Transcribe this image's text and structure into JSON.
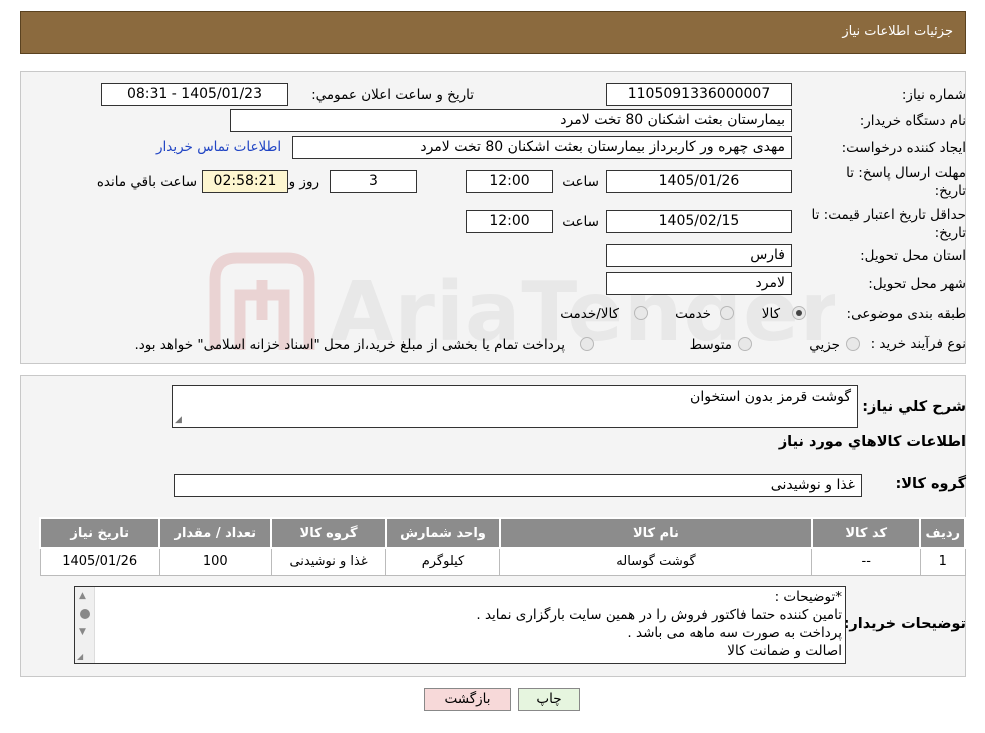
{
  "header": {
    "title": "جزئیات اطلاعات نیاز"
  },
  "form": {
    "need_number_label": "شماره نیاز:",
    "need_number": "1105091336000007",
    "announce_label": "تاریخ و ساعت اعلان عمومي:",
    "announce_value": "1405/01/23 - 08:31",
    "buyer_org_label": "نام دستگاه خريدار:",
    "buyer_org": "بیمارستان بعثت اشکنان 80 تخت لامرد",
    "creator_label": "ايجاد کننده درخواست:",
    "creator": "مهدی چهره ور کاربرداز بیمارستان بعثت اشکنان 80 تخت لامرد",
    "contact_link": "اطلاعات تماس خریدار",
    "deadline_label_1": "مهلت ارسال پاسخ: تا",
    "deadline_label_2": "تاریخ:",
    "deadline_date": "1405/01/26",
    "time_label": "ساعت",
    "deadline_time": "12:00",
    "days_value": "3",
    "days_label": "روز و",
    "remaining_time": "02:58:21",
    "remaining_label": "ساعت باقي مانده",
    "validity_label_1": "حداقل تاريخ اعتبار قيمت: تا",
    "validity_label_2": "تاریخ:",
    "validity_date": "1405/02/15",
    "validity_time": "12:00",
    "province_label": "استان محل تحويل:",
    "province": "فارس",
    "city_label": "شهر محل تحويل:",
    "city": "لامرد",
    "category_label": "طبقه بندی موضوعی:",
    "category_options": [
      "کالا",
      "خدمت",
      "کالا/خدمت"
    ],
    "category_selected": "کالا",
    "process_label": "نوع فرآيند خريد :",
    "process_options": [
      "جزيي",
      "متوسط"
    ],
    "process_note": "پرداخت تمام یا بخشی از مبلغ خرید،از محل \"اسناد خزانه اسلامی\" خواهد بود."
  },
  "summary": {
    "desc_label": "شرح کلي نياز:",
    "desc_value": "گوشت قرمز بدون استخوان",
    "goods_info_title": "اطلاعات کالاهاي مورد نياز",
    "goods_group_label": "گروه کالا:",
    "goods_group_value": "غذا و نوشیدنی",
    "table": {
      "headers": [
        "رديف",
        "کد کالا",
        "نام کالا",
        "واحد شمارش",
        "گروه کالا",
        "تعداد / مقدار",
        "تاريخ نياز"
      ],
      "rows": [
        [
          "1",
          "--",
          "گوشت گوساله",
          "کیلوگرم",
          "غذا و نوشیدنی",
          "100",
          "1405/01/26"
        ]
      ]
    },
    "buyer_notes_label": "توضیحات خریدار:",
    "buyer_notes": [
      "*توضیحات :",
      "تامین کننده حتما فاکتور فروش را در همین سایت بارگزاری نماید .",
      "پرداخت به صورت سه ماهه می باشد .",
      "اصالت و ضمانت کالا"
    ]
  },
  "buttons": {
    "print": "چاپ",
    "back": "بازگشت"
  },
  "watermark": {
    "text": "AriaTender.neT"
  },
  "colors": {
    "header_bg": "#8b6a3e",
    "table_header_bg": "#8c8c8c",
    "link": "#2145c4",
    "back_btn_bg": "#f7d9d9",
    "print_btn_bg": "#e6f5df"
  }
}
